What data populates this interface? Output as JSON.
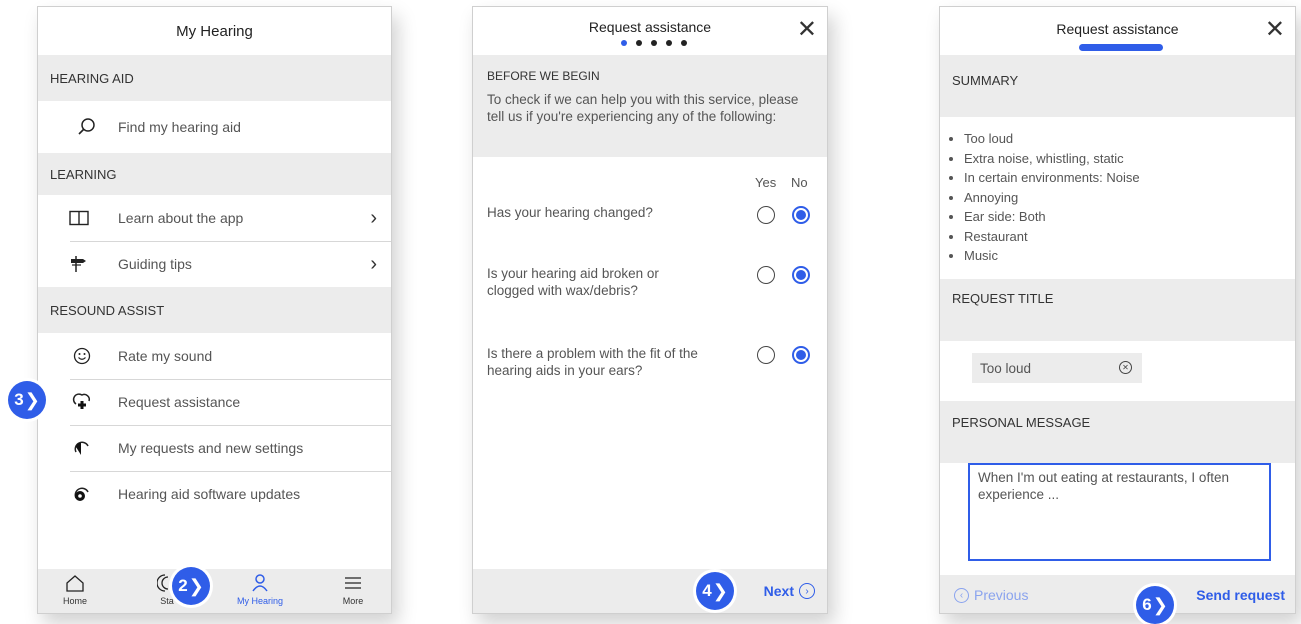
{
  "screen1": {
    "title": "My Hearing",
    "sections": [
      {
        "header": "HEARING AID"
      },
      {
        "header": "LEARNING"
      },
      {
        "header": "RESOUND ASSIST"
      }
    ],
    "items": {
      "find": "Find my hearing aid",
      "learn": "Learn about the app",
      "tips": "Guiding tips",
      "rate": "Rate my sound",
      "request": "Request assistance",
      "requests": "My requests and new settings",
      "updates": "Hearing aid software updates"
    },
    "nav": {
      "home": "Home",
      "status": "Sta",
      "myhearing": "My Hearing",
      "more": "More"
    },
    "badge_2": "2",
    "badge_3": "3"
  },
  "screen2": {
    "title": "Request assistance",
    "section": "BEFORE WE BEGIN",
    "intro": "To check if we can help you with this service, please tell us if you're experiencing any of the following:",
    "col_yes": "Yes",
    "col_no": "No",
    "questions": [
      {
        "text": "Has your hearing changed?",
        "answer": "No"
      },
      {
        "text": "Is your hearing aid broken or clogged with wax/debris?",
        "answer": "No"
      },
      {
        "text": "Is there a problem with the fit of the hearing aids in your ears?",
        "answer": "No"
      }
    ],
    "progress": {
      "current_step": 1,
      "total_steps": 5
    },
    "next_label": "Next",
    "badge_4": "4"
  },
  "screen3": {
    "title": "Request assistance",
    "summary_header": "SUMMARY",
    "summary_items": [
      "Too loud",
      "Extra noise, whistling, static",
      "In certain environments: Noise",
      "Annoying",
      "Ear side: Both",
      "Restaurant",
      "Music"
    ],
    "title_header": "REQUEST TITLE",
    "request_title_value": "Too loud",
    "message_header": "PERSONAL MESSAGE",
    "message_value": "When I'm out eating at restaurants, I often experience ...",
    "previous_label": "Previous",
    "send_label": "Send request",
    "badge_6": "6"
  },
  "colors": {
    "accent": "#2f5de8",
    "section_bg": "#ececec"
  }
}
